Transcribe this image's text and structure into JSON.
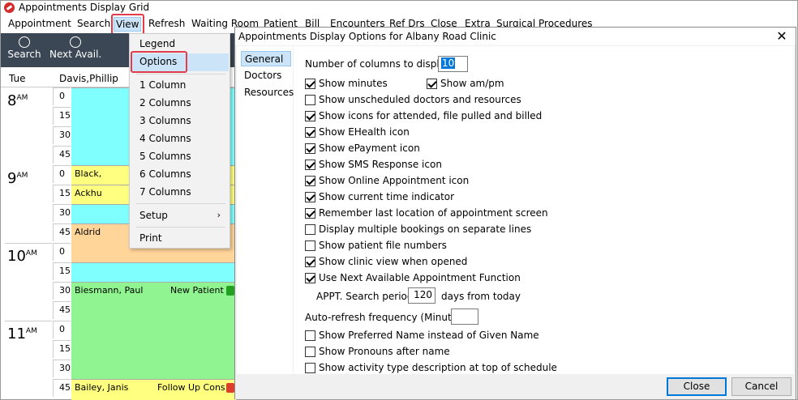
{
  "window": {
    "title": "Appointments Display Grid"
  },
  "menubar": {
    "items": [
      "Appointment",
      "Search",
      "View",
      "Refresh",
      "Waiting Room",
      "Patient",
      "Bill",
      "Encounters",
      "Ref Drs",
      "Close",
      "Extra",
      "Surgical Procedures"
    ]
  },
  "toolbar": {
    "search_label": "Search",
    "next_avail_label": "Next Avail."
  },
  "grid": {
    "day": "Tue",
    "doctor": "Davis,Phillip",
    "hours": [
      {
        "hour": "8",
        "ampm": "AM"
      },
      {
        "hour": "9",
        "ampm": "AM"
      },
      {
        "hour": "10",
        "ampm": "AM"
      },
      {
        "hour": "11",
        "ampm": "AM"
      }
    ],
    "minutes": [
      "0",
      "15",
      "30",
      "45"
    ],
    "appointments": [
      {
        "patient": "Black,",
        "type": ""
      },
      {
        "patient": "Ackhu",
        "type": ""
      },
      {
        "patient": "Aldrid",
        "type": ""
      },
      {
        "patient": "Biesmann, Paul",
        "type": "New Patient"
      },
      {
        "patient": "Bailey, Janis",
        "type": "Follow Up Cons"
      }
    ],
    "colors": {
      "empty": "#80ffff",
      "yellow": "#ffff80",
      "orange": "#ffd59a",
      "green": "#90f590"
    }
  },
  "view_menu": {
    "items": [
      "Legend",
      "Options",
      "1 Column",
      "2 Columns",
      "3 Columns",
      "4 Columns",
      "5 Columns",
      "6 Columns",
      "7 Columns",
      "Setup",
      "Print"
    ]
  },
  "dialog": {
    "title": "Appointments Display Options for Albany Road Clinic",
    "nav": [
      "General",
      "Doctors",
      "Resources"
    ],
    "num_columns_label": "Number of columns to display",
    "num_columns_value": "10",
    "options": [
      {
        "label": "Show minutes",
        "checked": true
      },
      {
        "label": "Show am/pm",
        "checked": true
      },
      {
        "label": "Show unscheduled doctors and resources",
        "checked": false
      },
      {
        "label": "Show icons for attended, file pulled and billed",
        "checked": true
      },
      {
        "label": "Show EHealth icon",
        "checked": true
      },
      {
        "label": "Show ePayment icon",
        "checked": true
      },
      {
        "label": "Show SMS Response icon",
        "checked": true
      },
      {
        "label": "Show Online Appointment icon",
        "checked": true
      },
      {
        "label": "Show current time indicator",
        "checked": true
      },
      {
        "label": "Remember last location of appointment screen",
        "checked": true
      },
      {
        "label": "Display multiple bookings on separate lines",
        "checked": false
      },
      {
        "label": "Show patient file numbers",
        "checked": false
      },
      {
        "label": "Show clinic view when opened",
        "checked": true
      },
      {
        "label": "Use Next Available Appointment Function",
        "checked": true
      }
    ],
    "appt_search_label": "APPT. Search period:",
    "appt_search_value": "120",
    "appt_search_suffix": "days from today",
    "auto_refresh_label": "Auto-refresh frequency (Minutes):",
    "auto_refresh_value": "",
    "options2": [
      {
        "label": "Show Preferred Name instead of Given Name",
        "checked": false
      },
      {
        "label": "Show Pronouns after name",
        "checked": false
      },
      {
        "label": "Show activity type description at top of schedule",
        "checked": false
      }
    ],
    "close_label": "Close",
    "cancel_label": "Cancel"
  }
}
